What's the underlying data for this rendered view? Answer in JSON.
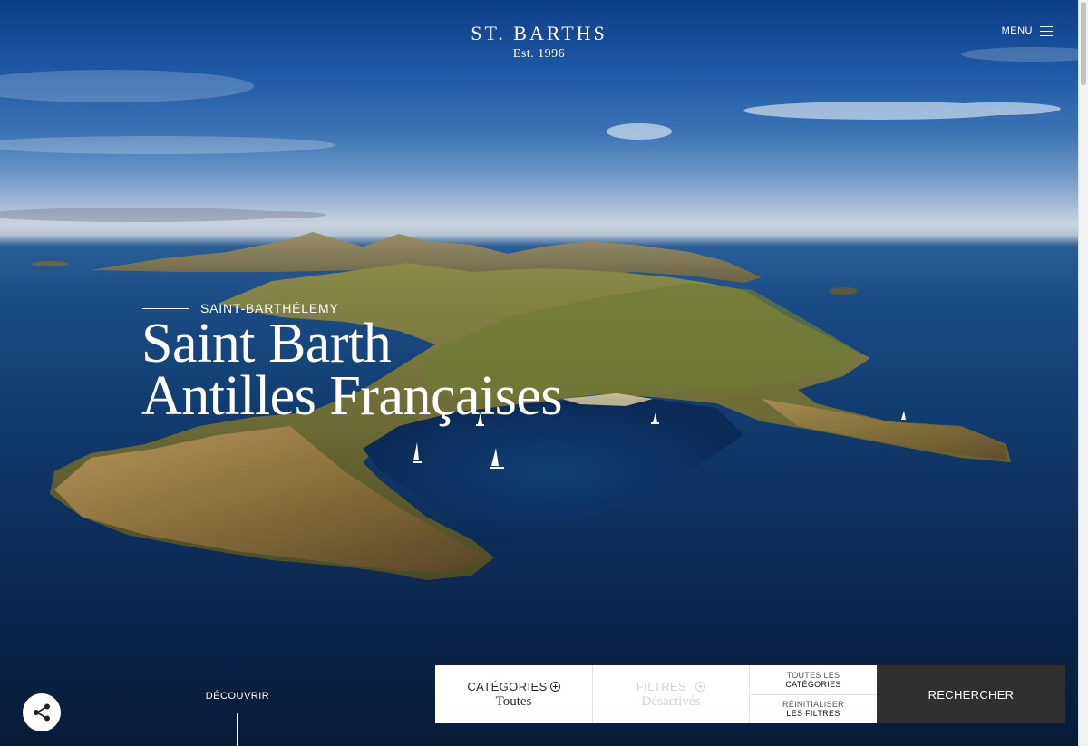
{
  "header": {
    "brand_name": "ST. BARTHS",
    "brand_est": "Est. 1996",
    "menu_label": "MENU"
  },
  "hero": {
    "kicker": "SAINT-BARTHÉLEMY",
    "headline_line1": "Saint Barth",
    "headline_line2": "Antilles Françaises",
    "discover_label": "DÉCOUVRIR"
  },
  "filterbar": {
    "categories_label": "CATÉGORIES",
    "categories_value": "Toutes",
    "filters_label": "FILTRES",
    "filters_value": "Désactivés",
    "all_categories_line1": "TOUTES LES",
    "all_categories_line2": "CATÉGORIES",
    "reset_line1": "RÉINITIALISER",
    "reset_line2": "LES FILTRES",
    "search_label": "RECHERCHER"
  },
  "icons": {
    "share": "share-icon",
    "menu": "hamburger-icon",
    "plus": "plus-circle-icon"
  },
  "colors": {
    "search_button_bg": "#303030",
    "filter_bg": "#ffffff",
    "disabled_text": "#d3d3d3"
  }
}
